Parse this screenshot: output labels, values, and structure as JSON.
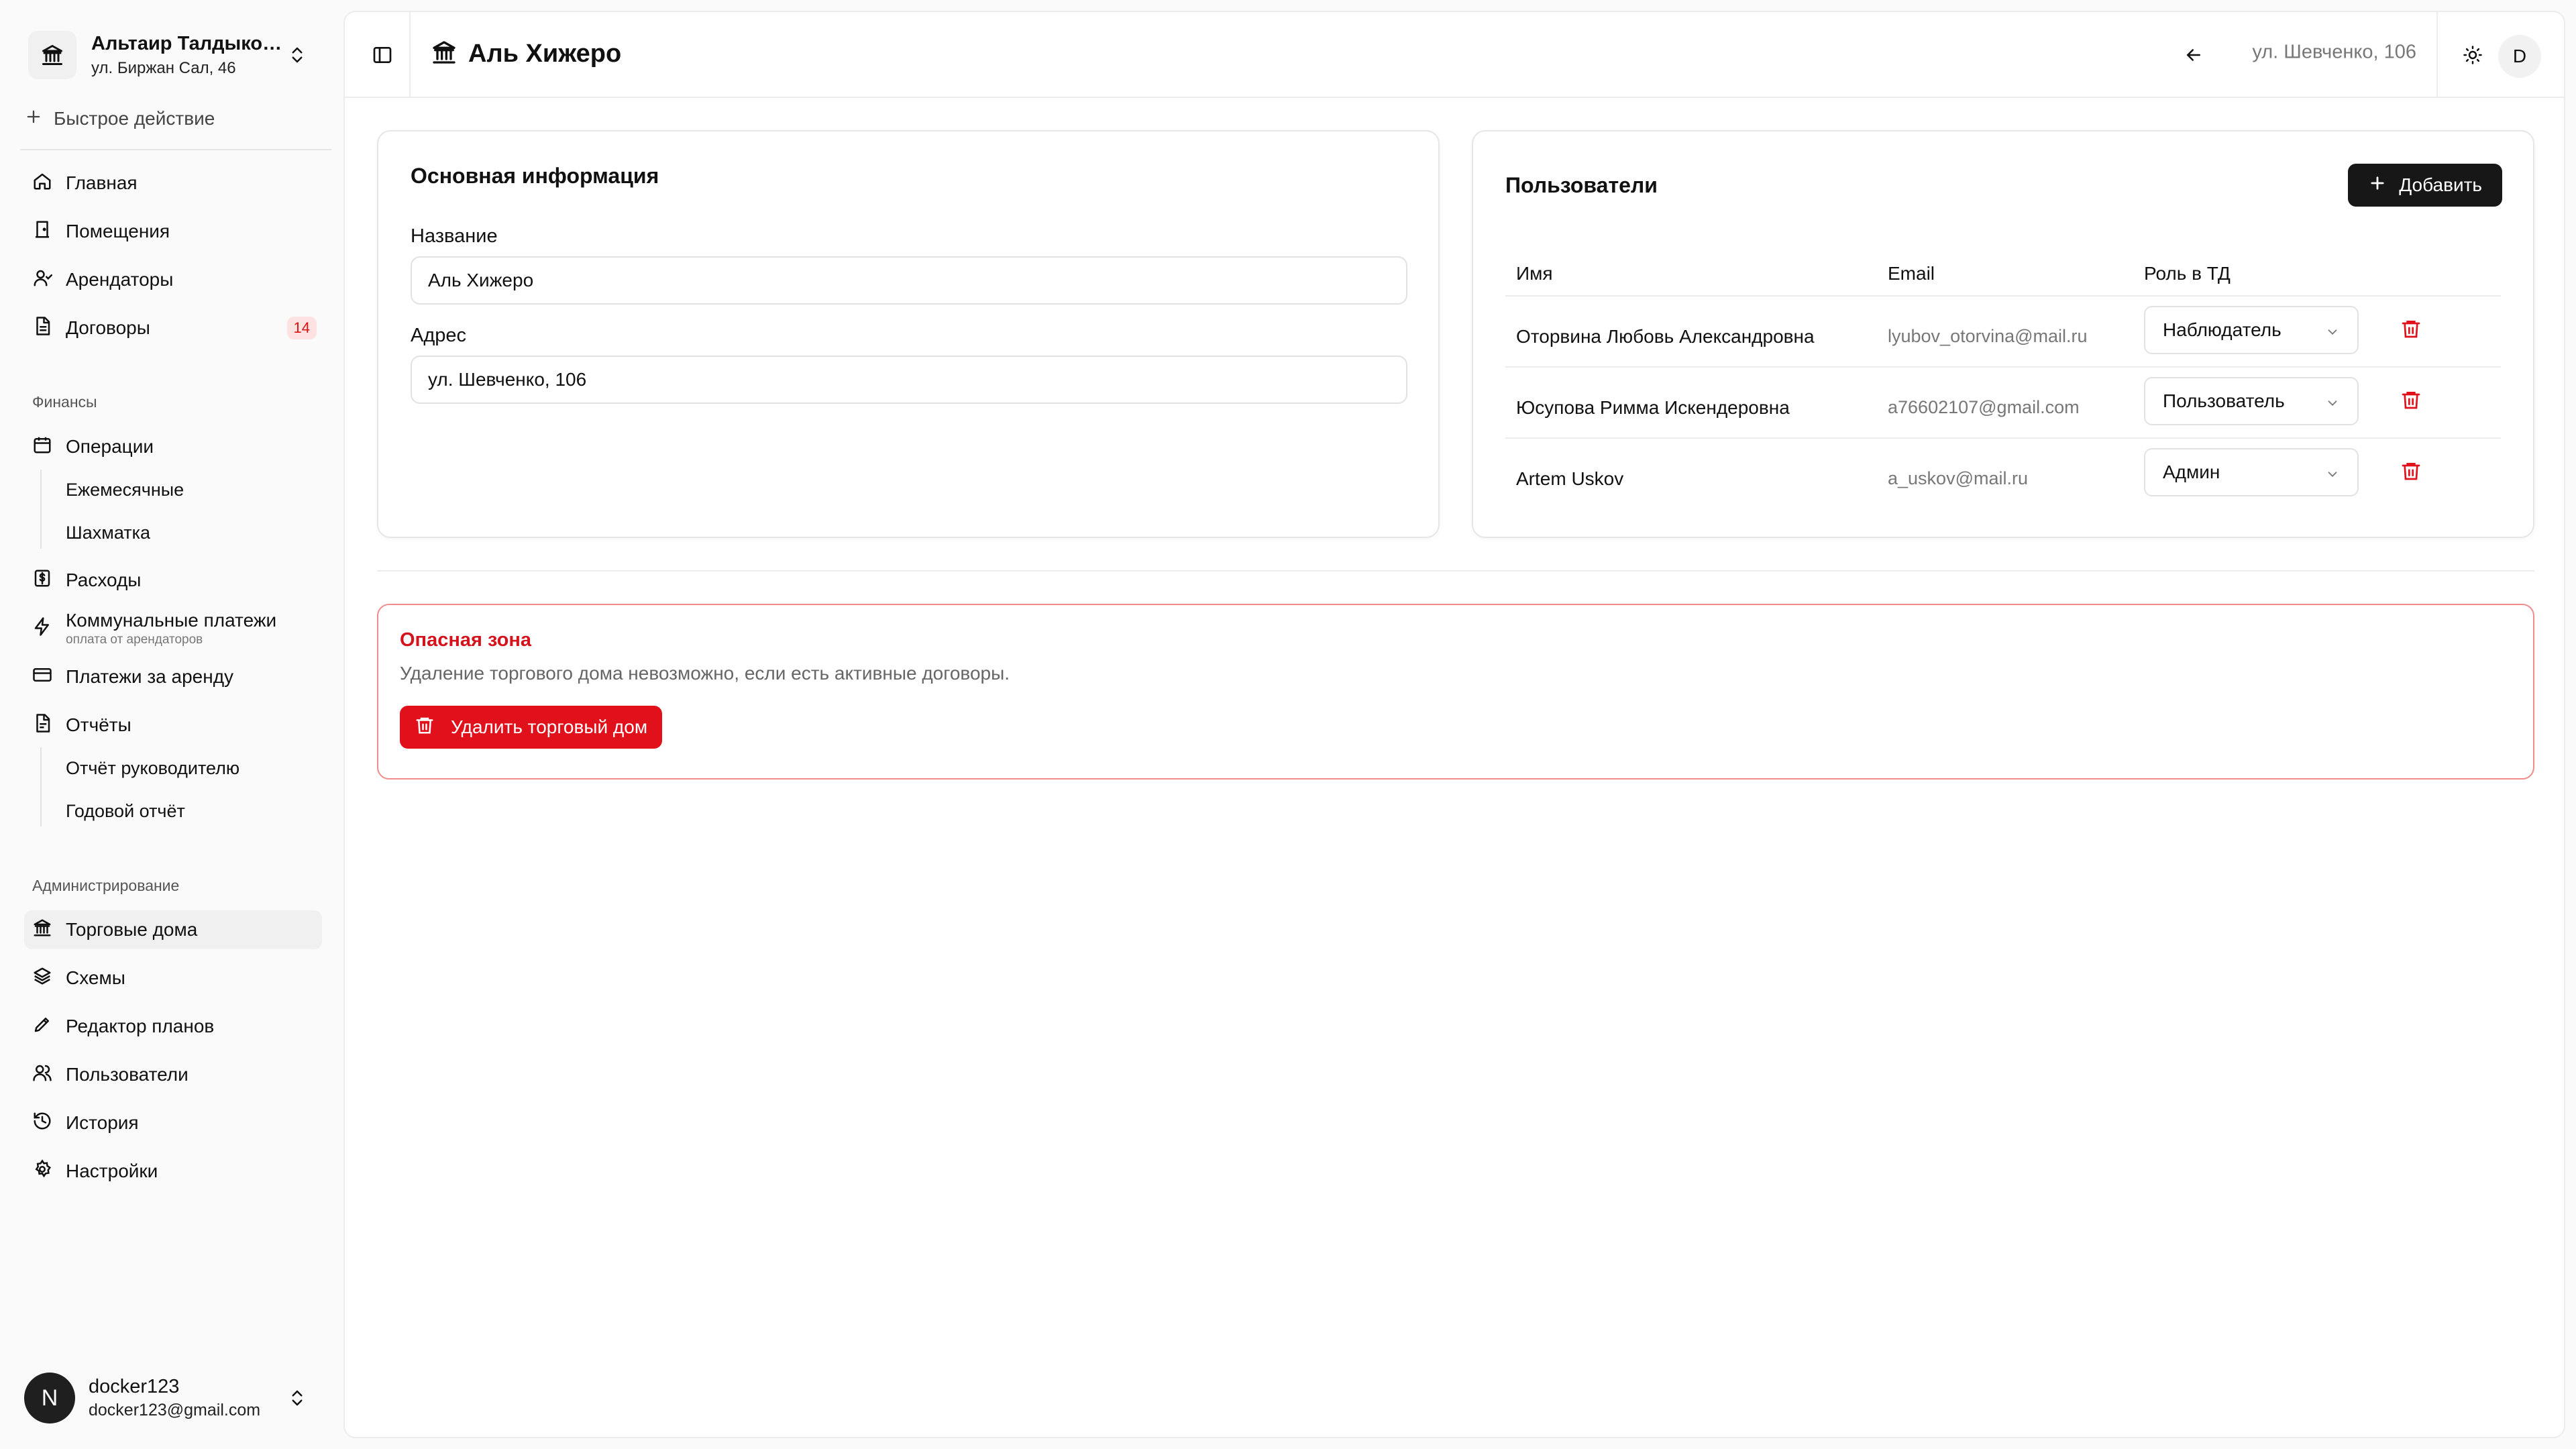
{
  "org": {
    "name": "Альтаир Талдыкорган",
    "address": "ул. Биржан Сал, 46"
  },
  "sidebar": {
    "quick_action": "Быстрое действие",
    "main_items": [
      {
        "label": "Главная",
        "icon": "home-icon"
      },
      {
        "label": "Помещения",
        "icon": "door-icon"
      },
      {
        "label": "Арендаторы",
        "icon": "user-icon"
      },
      {
        "label": "Договоры",
        "icon": "document-icon",
        "badge": "14"
      }
    ],
    "finance_section": "Финансы",
    "finance_items": {
      "operations": "Операции",
      "monthly": "Ежемесячные",
      "chess": "Шахматка",
      "expenses": "Расходы",
      "utilities": "Коммунальные платежи",
      "utilities_sub": "оплата от арендаторов",
      "rent_payments": "Платежи за аренду",
      "reports": "Отчёты",
      "manager_report": "Отчёт руководителю",
      "annual_report": "Годовой отчёт"
    },
    "admin_section": "Администрирование",
    "admin_items": [
      {
        "label": "Торговые дома",
        "icon": "bank-icon",
        "active": true
      },
      {
        "label": "Схемы",
        "icon": "layers-icon"
      },
      {
        "label": "Редактор планов",
        "icon": "pen-icon"
      },
      {
        "label": "Пользователи",
        "icon": "users-icon"
      },
      {
        "label": "История",
        "icon": "history-icon"
      },
      {
        "label": "Настройки",
        "icon": "gear-icon"
      }
    ]
  },
  "user": {
    "initial": "N",
    "name": "docker123",
    "email": "docker123@gmail.com"
  },
  "header": {
    "title": "Аль Хижеро",
    "address": "ул. Шевченко, 106",
    "avatar": "D"
  },
  "info_card": {
    "title": "Основная информация",
    "name_label": "Название",
    "name_value": "Аль Хижеро",
    "address_label": "Адрес",
    "address_value": "ул. Шевченко, 106"
  },
  "users_card": {
    "title": "Пользователи",
    "add_label": "Добавить",
    "columns": [
      "Имя",
      "Email",
      "Роль в ТД"
    ],
    "rows": [
      {
        "name": "Оторвина Любовь Александровна",
        "email": "lyubov_otorvina@mail.ru",
        "role": "Наблюдатель"
      },
      {
        "name": "Юсупова Римма Искендеровна",
        "email": "a76602107@gmail.com",
        "role": "Пользователь"
      },
      {
        "name": "Artem Uskov",
        "email": "a_uskov@mail.ru",
        "role": "Админ"
      }
    ]
  },
  "danger": {
    "title": "Опасная зона",
    "description": "Удаление торгового дома невозможно, если есть активные договоры.",
    "button": "Удалить торговый дом"
  },
  "colors": {
    "danger": "#e0111b",
    "primary": "#171717",
    "badge_bg": "#fde2e2"
  }
}
